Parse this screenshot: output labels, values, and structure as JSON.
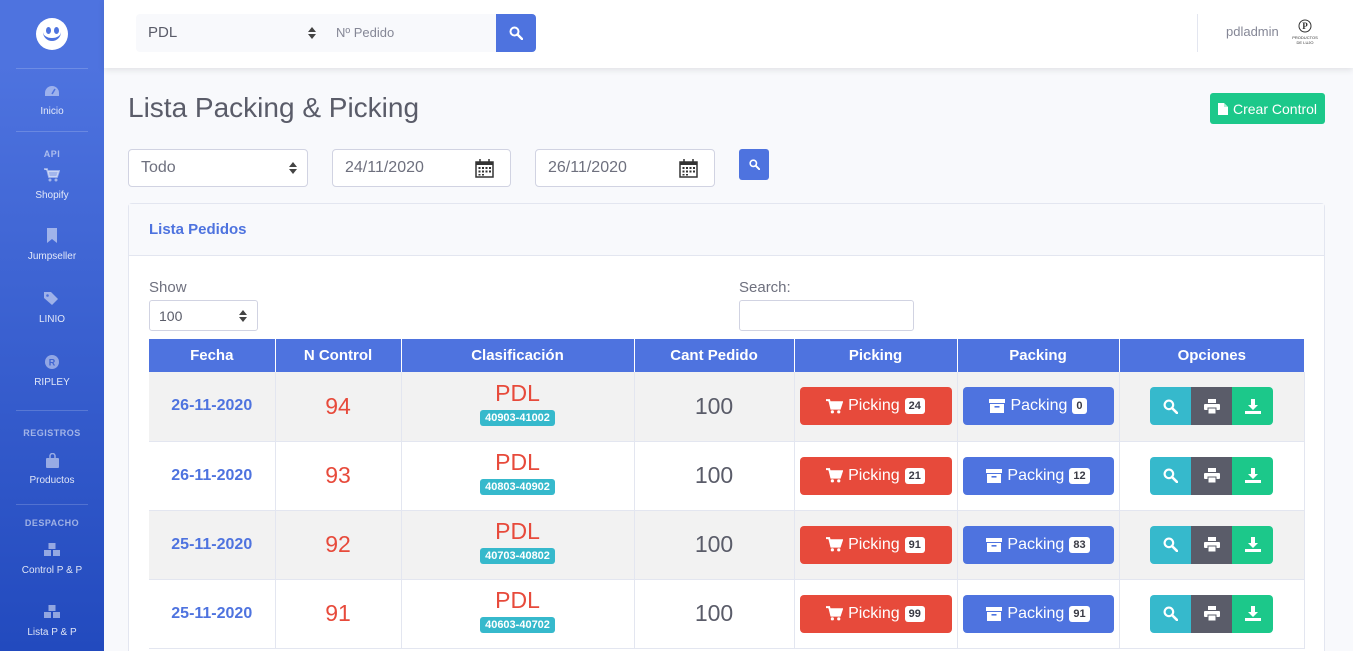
{
  "sidebar": {
    "items": [
      {
        "label": "Inicio",
        "icon": "dashboard-icon"
      },
      {
        "label": "Shopify",
        "icon": "cart-icon"
      },
      {
        "label": "Jumpseller",
        "icon": "bookmark-icon"
      },
      {
        "label": "LINIO",
        "icon": "tags-icon"
      },
      {
        "label": "RIPLEY",
        "icon": "ripley-icon"
      },
      {
        "label": "Productos",
        "icon": "bag-icon"
      },
      {
        "label": "Control P & P",
        "icon": "cubes-icon"
      },
      {
        "label": "Lista P & P",
        "icon": "cubes-icon"
      }
    ],
    "headings": [
      "API",
      "REGISTROS",
      "DESPACHO"
    ]
  },
  "topbar": {
    "store_select": "PDL",
    "order_placeholder": "Nº Pedido",
    "username": "pdladmin",
    "avatar_text": "PRODUCTOS DE LUJO"
  },
  "page": {
    "title": "Lista Packing & Picking",
    "create_button": "Crear Control"
  },
  "filters": {
    "type": "Todo",
    "date_from": "24/11/2020",
    "date_to": "26/11/2020"
  },
  "card": {
    "title": "Lista Pedidos",
    "show_label": "Show",
    "show_value": "100",
    "search_label": "Search:"
  },
  "table": {
    "headers": [
      "Fecha",
      "N Control",
      "Clasificación",
      "Cant Pedido",
      "Picking",
      "Packing",
      "Opciones"
    ],
    "rows": [
      {
        "fecha": "26-11-2020",
        "control": "94",
        "clas": "PDL",
        "range": "40903-41002",
        "cant": "100",
        "picking_label": "Picking",
        "picking": "24",
        "packing_label": "Packing",
        "packing": "0"
      },
      {
        "fecha": "26-11-2020",
        "control": "93",
        "clas": "PDL",
        "range": "40803-40902",
        "cant": "100",
        "picking_label": "Picking",
        "picking": "21",
        "packing_label": "Packing",
        "packing": "12"
      },
      {
        "fecha": "25-11-2020",
        "control": "92",
        "clas": "PDL",
        "range": "40703-40802",
        "cant": "100",
        "picking_label": "Picking",
        "picking": "91",
        "packing_label": "Packing",
        "packing": "83"
      },
      {
        "fecha": "25-11-2020",
        "control": "91",
        "clas": "PDL",
        "range": "40603-40702",
        "cant": "100",
        "picking_label": "Picking",
        "picking": "99",
        "packing_label": "Packing",
        "packing": "91"
      }
    ]
  },
  "colors": {
    "primary": "#4e73df",
    "danger": "#e74a3b",
    "success": "#1cc88a",
    "info": "#36b9cc",
    "secondary": "#5a5c69"
  }
}
